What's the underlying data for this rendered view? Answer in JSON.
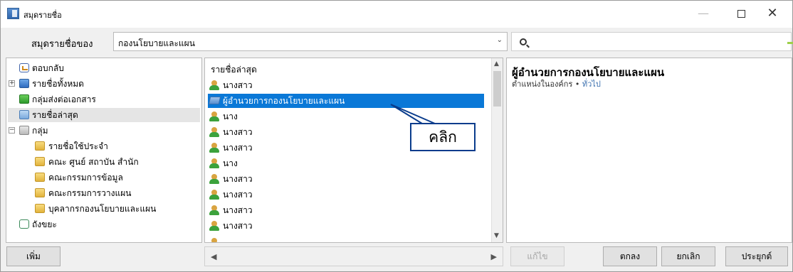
{
  "window": {
    "title": "สมุดรายชื่อ"
  },
  "address": {
    "label": "สมุดรายชื่อของ",
    "selected": "กองนโยบายและแผน",
    "search_placeholder": ""
  },
  "sidebar": {
    "items": [
      {
        "label": "ตอบกลับ",
        "icon": "reply-icon"
      },
      {
        "label": "รายชื่อทั้งหมด",
        "icon": "address-book-icon"
      },
      {
        "label": "กลุ่มส่งต่อเอกสาร",
        "icon": "forward-group-icon"
      },
      {
        "label": "รายชื่อล่าสุด",
        "icon": "recent-icon"
      },
      {
        "label": "กลุ่ม",
        "icon": "group-icon"
      },
      {
        "label": "รายชื่อใช้ประจำ",
        "icon": "folder-favorite-icon"
      },
      {
        "label": "คณะ ศูนย์ สถาบัน สำนัก",
        "icon": "folder-icon"
      },
      {
        "label": "คณะกรรมการข้อมูล",
        "icon": "folder-icon"
      },
      {
        "label": "คณะกรรมการวางแผน",
        "icon": "folder-icon"
      },
      {
        "label": "บุคลากรกองนโยบายและแผน",
        "icon": "folder-icon"
      },
      {
        "label": "ถังขยะ",
        "icon": "trash-icon"
      }
    ]
  },
  "list": {
    "header": "รายชื่อล่าสุด",
    "rows": [
      "นางสาว",
      "ผู้อำนวยการกองนโยบายและแผน",
      "นาง",
      "นางสาว",
      "นางสาว",
      "นาง",
      "นางสาว",
      "นางสาว",
      "นางสาว",
      "นางสาว"
    ]
  },
  "callout": {
    "text": "คลิก"
  },
  "detail": {
    "title": "ผู้อำนวยการกองนโยบายและแผน",
    "subtitle_prefix": "ตำแหน่งในองค์กร",
    "subtitle_separator": "•",
    "subtitle_link": "ทั่วไป"
  },
  "buttons": {
    "add": "เพิ่ม",
    "edit": "แก้ไข",
    "ok": "ตกลง",
    "cancel": "ยกเลิก",
    "apply": "ประยุกต์"
  },
  "colors": {
    "selection": "#0a78d7",
    "callout_border": "#0a3c8c",
    "accent": "#9ed04a"
  }
}
